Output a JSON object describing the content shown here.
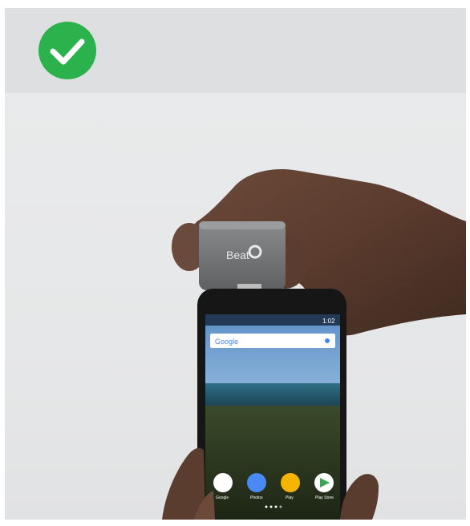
{
  "header": {
    "status_icon": "checkmark-circle-icon",
    "status_color": "#2bb24c"
  },
  "photo": {
    "device_brand": "Beat",
    "phone_search_label": "Google",
    "home_app_labels": [
      "Google",
      "Photos",
      "Play",
      "Play Store"
    ],
    "status_time": "1:02"
  }
}
